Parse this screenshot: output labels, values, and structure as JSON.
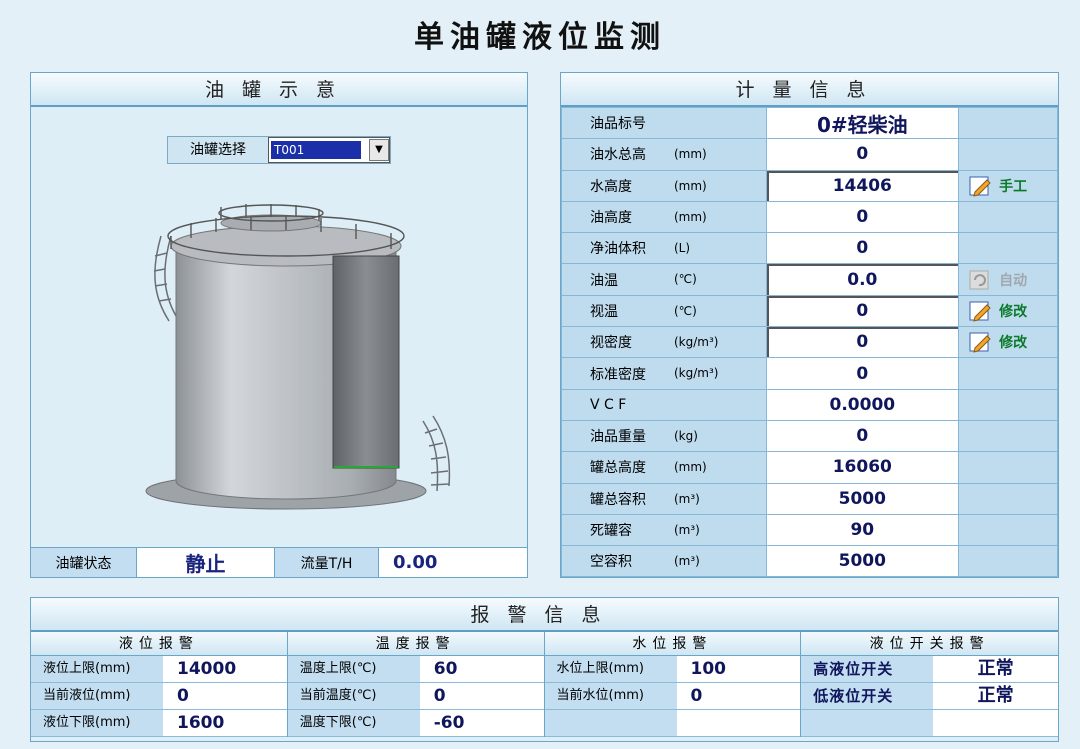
{
  "title": "单油罐液位监测",
  "tank_panel": {
    "header": "油罐示意",
    "select_label": "油罐选择",
    "select_value": "T001",
    "status_label": "油罐状态",
    "status_value": "静止",
    "flow_label": "流量T/H",
    "flow_value": "0.00"
  },
  "measure_panel": {
    "header": "计量信息",
    "rows": [
      {
        "name": "油品标号",
        "unit": "",
        "value": "0#轻柴油",
        "action": ""
      },
      {
        "name": "油水总高",
        "unit": "(mm)",
        "value": "0",
        "action": ""
      },
      {
        "name": "水高度",
        "unit": "(mm)",
        "value": "14406",
        "action": "手工"
      },
      {
        "name": "油高度",
        "unit": "(mm)",
        "value": "0",
        "action": ""
      },
      {
        "name": "净油体积",
        "unit": "(L)",
        "value": "0",
        "action": ""
      },
      {
        "name": "油温",
        "unit": "(℃)",
        "value": "0.0",
        "action": "自动"
      },
      {
        "name": "视温",
        "unit": "(℃)",
        "value": "0",
        "action": "修改"
      },
      {
        "name": "视密度",
        "unit": "(kg/m³)",
        "value": "0",
        "action": "修改"
      },
      {
        "name": "标准密度",
        "unit": "(kg/m³)",
        "value": "0",
        "action": ""
      },
      {
        "name": "V C F",
        "unit": "",
        "value": "0.0000",
        "action": ""
      },
      {
        "name": "油品重量",
        "unit": "(kg)",
        "value": "0",
        "action": ""
      },
      {
        "name": "罐总高度",
        "unit": "(mm)",
        "value": "16060",
        "action": ""
      },
      {
        "name": "罐总容积",
        "unit": "(m³)",
        "value": "5000",
        "action": ""
      },
      {
        "name": "死罐容",
        "unit": "(m³)",
        "value": "90",
        "action": ""
      },
      {
        "name": "空容积",
        "unit": "(m³)",
        "value": "5000",
        "action": ""
      }
    ]
  },
  "alarm_panel": {
    "header": "报警信息",
    "groups": [
      {
        "title": "液位报警",
        "rows": [
          {
            "label": "液位上限(mm)",
            "value": "14000"
          },
          {
            "label": "当前液位(mm)",
            "value": "0"
          },
          {
            "label": "液位下限(mm)",
            "value": "1600"
          }
        ]
      },
      {
        "title": "温度报警",
        "rows": [
          {
            "label": "温度上限(℃)",
            "value": "60"
          },
          {
            "label": "当前温度(℃)",
            "value": "0"
          },
          {
            "label": "温度下限(℃)",
            "value": "-60"
          }
        ]
      },
      {
        "title": "水位报警",
        "rows": [
          {
            "label": "水位上限(mm)",
            "value": "100"
          },
          {
            "label": "当前水位(mm)",
            "value": "0"
          },
          {
            "label": "",
            "value": ""
          }
        ]
      },
      {
        "title": "液位开关报警",
        "rows": [
          {
            "label": "高液位开关",
            "value": "正常"
          },
          {
            "label": "低液位开关",
            "value": "正常"
          },
          {
            "label": "",
            "value": ""
          }
        ]
      }
    ]
  }
}
